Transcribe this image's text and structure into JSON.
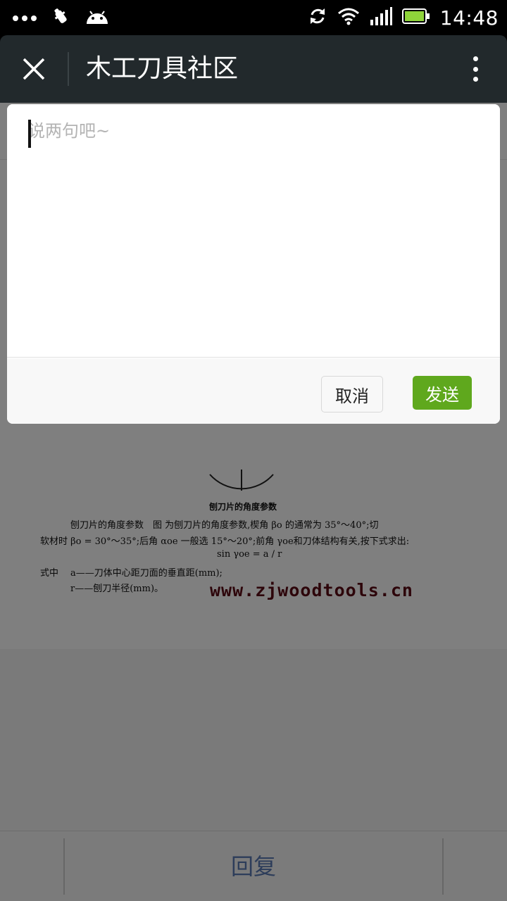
{
  "status_bar": {
    "time": "14:48",
    "left_icons": [
      "more-dots-icon",
      "bug-icon",
      "android-icon"
    ],
    "right_icons": [
      "sync-icon",
      "wifi-icon",
      "signal-icon",
      "battery-icon"
    ]
  },
  "title_bar": {
    "title": "木工刀具社区"
  },
  "compose": {
    "placeholder": "说两句吧~",
    "value": ""
  },
  "actions": {
    "cancel_label": "取消",
    "send_label": "发送"
  },
  "article": {
    "figure_caption": "刨刀片的角度参数",
    "line1": "刨刀片的角度参数　图 为刨刀片的角度参数,楔角 βo 的通常为 35°～40°;切",
    "line2": "软材时 βo = 30°～35°;后角 αoe 一般选 15°～20°;前角 γoe和刀体结构有关,按下式求出:",
    "formula": "sin γoe = a / r",
    "where_label": "式中",
    "where_a": "a——刀体中心距刀面的垂直距(mm);",
    "where_r": "r——刨刀半径(mm)。",
    "watermark": "www.zjwoodtools.cn"
  },
  "footer": {
    "reply_label": "回复"
  },
  "colors": {
    "title_bar_bg": "#22292c",
    "send_button": "#5fa81d",
    "reply_text": "#5a7ab4",
    "watermark": "#5a0a14"
  }
}
